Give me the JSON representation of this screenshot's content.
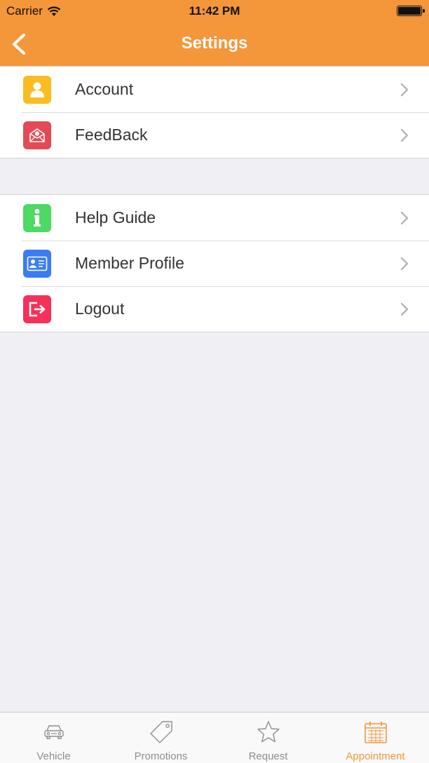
{
  "status_bar": {
    "carrier": "Carrier",
    "time": "11:42 PM"
  },
  "header": {
    "title": "Settings"
  },
  "groups": [
    {
      "items": [
        {
          "label": "Account",
          "icon": "account-icon",
          "color": "#f9bd22"
        },
        {
          "label": "FeedBack",
          "icon": "feedback-icon",
          "color": "#e34a55"
        }
      ]
    },
    {
      "items": [
        {
          "label": "Help Guide",
          "icon": "info-icon",
          "color": "#4cd964"
        },
        {
          "label": "Member Profile",
          "icon": "id-card-icon",
          "color": "#3b7cf3"
        },
        {
          "label": "Logout",
          "icon": "logout-icon",
          "color": "#f5315a"
        }
      ]
    }
  ],
  "tabs": [
    {
      "label": "Vehicle",
      "icon": "car-icon",
      "active": false
    },
    {
      "label": "Promotions",
      "icon": "tag-icon",
      "active": false
    },
    {
      "label": "Request",
      "icon": "star-icon",
      "active": false
    },
    {
      "label": "Appointment",
      "icon": "calendar-icon",
      "active": true
    }
  ],
  "colors": {
    "accent": "#f4963a",
    "background": "#efeff4",
    "inactive_tab": "#8e8e93"
  }
}
